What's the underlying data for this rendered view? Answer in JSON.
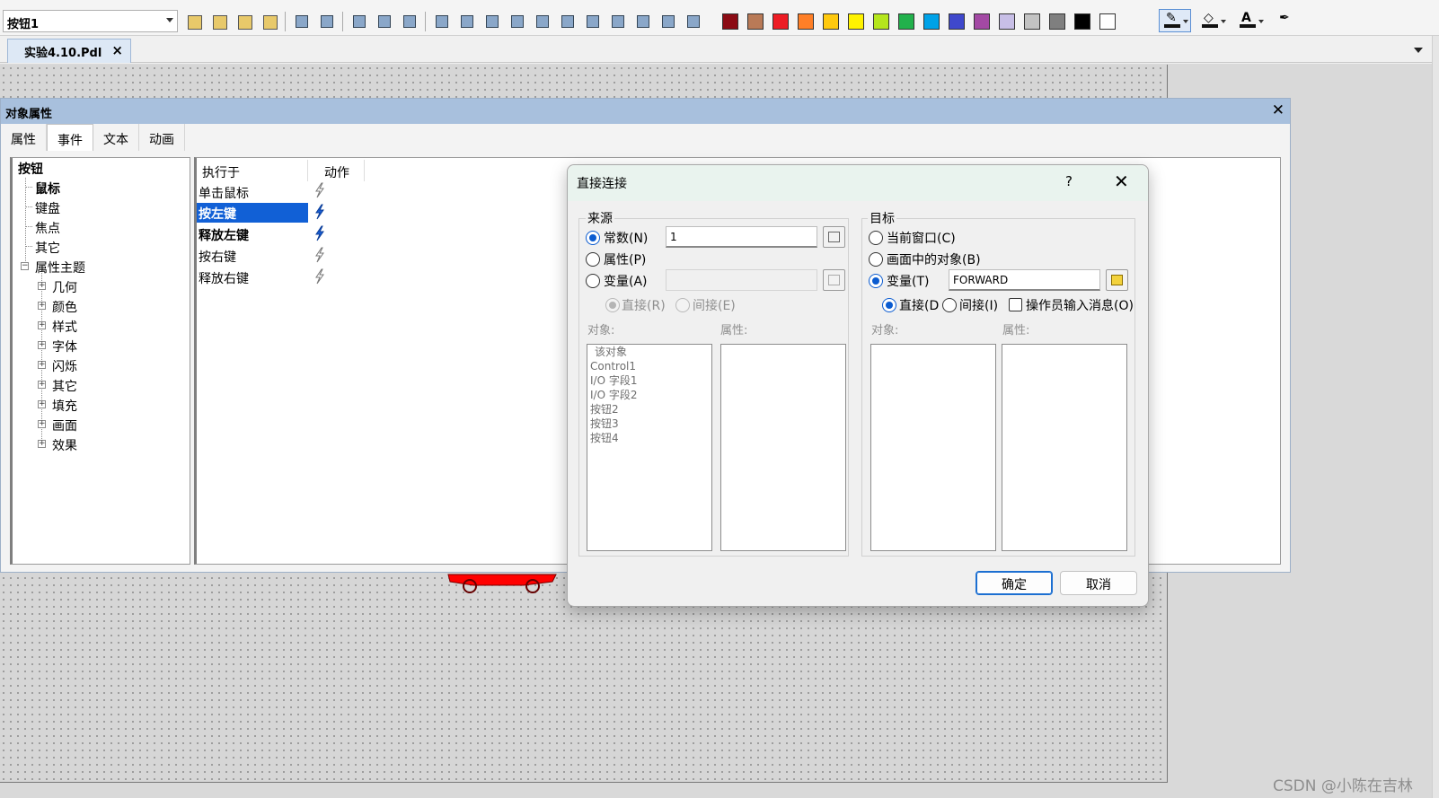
{
  "toolbar": {
    "object_selector": "按钮1",
    "palette_colors": [
      "#8b0b14",
      "#b97a57",
      "#ed1c24",
      "#ff7f27",
      "#ffc90e",
      "#fff200",
      "#b5e61d",
      "#22b14c",
      "#00a2e8",
      "#3f48cc",
      "#a349a4",
      "#c8bfe7",
      "#c3c3c3",
      "#7f7f7f",
      "#000000",
      "#ffffff"
    ],
    "text_color_glyph": "A"
  },
  "document_tab": {
    "label": "实验4.10.Pdl"
  },
  "properties_panel": {
    "title": "对象属性",
    "tabs": [
      "属性",
      "事件",
      "文本",
      "动画"
    ],
    "selected_tab": "事件",
    "tree": {
      "root": "按钮",
      "event_items": [
        "鼠标",
        "键盘",
        "焦点",
        "其它"
      ],
      "property_group": "属性主题",
      "property_items": [
        "几何",
        "颜色",
        "样式",
        "字体",
        "闪烁",
        "其它",
        "填充",
        "画面",
        "效果"
      ]
    },
    "event_list": {
      "headers": [
        "执行于",
        "动作"
      ],
      "rows": [
        "单击鼠标",
        "按左键",
        "释放左键",
        "按右键",
        "释放右键"
      ],
      "selected_row": "按左键"
    }
  },
  "dialog": {
    "title": "直接连接",
    "help": "?",
    "source": {
      "label": "来源",
      "constant_label": "常数(N)",
      "constant_value": "1",
      "property_label": "属性(P)",
      "variable_label": "变量(A)",
      "direct_label": "直接(R)",
      "indirect_label": "间接(E)",
      "objects_header": "对象:",
      "properties_header": "属性:",
      "objects": [
        "该对象",
        "Control1",
        "I/O 字段1",
        "I/O 字段2",
        "按钮2",
        "按钮3",
        "按钮4"
      ]
    },
    "target": {
      "label": "目标",
      "current_window_label": "当前窗口(C)",
      "object_in_picture_label": "画面中的对象(B)",
      "variable_label": "变量(T)",
      "variable_value": "FORWARD",
      "direct_label": "直接(D)",
      "indirect_label": "间接(I)",
      "operator_input_label": "操作员输入消息(O)",
      "objects_header": "对象:",
      "properties_header": "属性:"
    },
    "ok_label": "确定",
    "cancel_label": "取消"
  },
  "canvas": {
    "car_color": "#ff0000"
  },
  "watermark": "CSDN @小陈在吉林"
}
